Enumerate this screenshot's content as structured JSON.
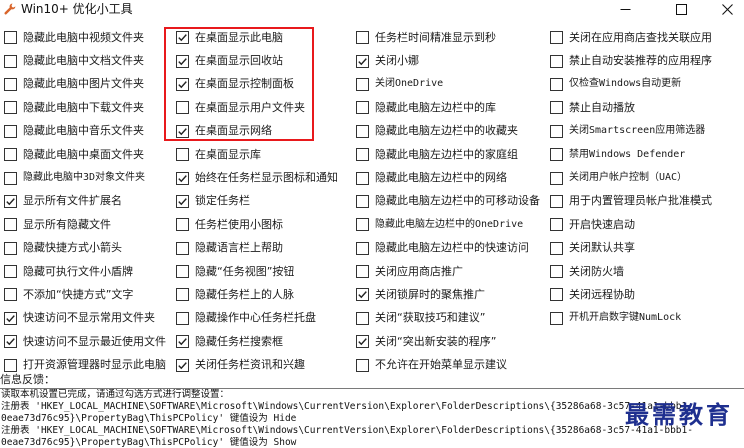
{
  "window": {
    "title": "Win10+ 优化小工具",
    "icon": "wrench-icon"
  },
  "columns": [
    [
      {
        "label": "隐藏此电脑中视频文件夹",
        "checked": false
      },
      {
        "label": "隐藏此电脑中文档文件夹",
        "checked": false
      },
      {
        "label": "隐藏此电脑中图片文件夹",
        "checked": false
      },
      {
        "label": "隐藏此电脑中下载文件夹",
        "checked": false
      },
      {
        "label": "隐藏此电脑中音乐文件夹",
        "checked": false
      },
      {
        "label": "隐藏此电脑中桌面文件夹",
        "checked": false
      },
      {
        "label": "隐藏此电脑中3D对象文件夹",
        "checked": false
      },
      {
        "label": "显示所有文件扩展名",
        "checked": true
      },
      {
        "label": "显示所有隐藏文件",
        "checked": false
      },
      {
        "label": "隐藏快捷方式小箭头",
        "checked": false
      },
      {
        "label": "隐藏可执行文件小盾牌",
        "checked": false
      },
      {
        "label": "不添加“快捷方式”文字",
        "checked": false
      },
      {
        "label": "快速访问不显示常用文件夹",
        "checked": true
      },
      {
        "label": "快速访问不显示最近使用文件",
        "checked": true
      },
      {
        "label": "打开资源管理器时显示此电脑",
        "checked": false
      }
    ],
    [
      {
        "label": "在桌面显示此电脑",
        "checked": true
      },
      {
        "label": "在桌面显示回收站",
        "checked": true
      },
      {
        "label": "在桌面显示控制面板",
        "checked": true
      },
      {
        "label": "在桌面显示用户文件夹",
        "checked": false
      },
      {
        "label": "在桌面显示网络",
        "checked": true
      },
      {
        "label": "在桌面显示库",
        "checked": false
      },
      {
        "label": "始终在任务栏显示图标和通知",
        "checked": true
      },
      {
        "label": "锁定任务栏",
        "checked": true
      },
      {
        "label": "任务栏使用小图标",
        "checked": false
      },
      {
        "label": "隐藏语言栏上帮助",
        "checked": false
      },
      {
        "label": "隐藏“任务视图”按钮",
        "checked": false
      },
      {
        "label": "隐藏任务栏上的人脉",
        "checked": false
      },
      {
        "label": "隐藏操作中心任务栏托盘",
        "checked": false
      },
      {
        "label": "隐藏任务栏搜索框",
        "checked": true
      },
      {
        "label": "关闭任务栏资讯和兴趣",
        "checked": true
      }
    ],
    [
      {
        "label": "任务栏时间精准显示到秒",
        "checked": false
      },
      {
        "label": "关闭小娜",
        "checked": true
      },
      {
        "label": "关闭OneDrive",
        "checked": false
      },
      {
        "label": "隐藏此电脑左边栏中的库",
        "checked": false
      },
      {
        "label": "隐藏此电脑左边栏中的收藏夹",
        "checked": false
      },
      {
        "label": "隐藏此电脑左边栏中的家庭组",
        "checked": false
      },
      {
        "label": "隐藏此电脑左边栏中的网络",
        "checked": false
      },
      {
        "label": "隐藏此电脑左边栏中的可移动设备",
        "checked": false
      },
      {
        "label": "隐藏此电脑左边栏中的OneDrive",
        "checked": false
      },
      {
        "label": "隐藏此电脑左边栏中的快速访问",
        "checked": false
      },
      {
        "label": "关闭应用商店推广",
        "checked": false
      },
      {
        "label": "关闭锁屏时的聚焦推广",
        "checked": true
      },
      {
        "label": "关闭“获取技巧和建议”",
        "checked": false
      },
      {
        "label": "关闭“突出新安装的程序”",
        "checked": true
      },
      {
        "label": "不允许在开始菜单显示建议",
        "checked": false
      }
    ],
    [
      {
        "label": "关闭在应用商店查找关联应用",
        "checked": false
      },
      {
        "label": "禁止自动安装推荐的应用程序",
        "checked": false
      },
      {
        "label": "仅检查Windows自动更新",
        "checked": false
      },
      {
        "label": "禁止自动播放",
        "checked": false
      },
      {
        "label": "关闭Smartscreen应用筛选器",
        "checked": false
      },
      {
        "label": "禁用Windows Defender",
        "checked": false
      },
      {
        "label": "关闭用户帐户控制（UAC）",
        "checked": false
      },
      {
        "label": "用于内置管理员帐户批准模式",
        "checked": false
      },
      {
        "label": "开启快速启动",
        "checked": false
      },
      {
        "label": "关闭默认共享",
        "checked": false
      },
      {
        "label": "关闭防火墙",
        "checked": false
      },
      {
        "label": "关闭远程协助",
        "checked": false
      },
      {
        "label": "开机开启数字键NumLock",
        "checked": false
      }
    ]
  ],
  "feedback": {
    "label": "信息反馈：",
    "lines": [
      "读取本机设置已完成，请通过勾选方式进行调整设置：",
      "注册表 'HKEY_LOCAL_MACHINE\\SOFTWARE\\Microsoft\\Windows\\CurrentVersion\\Explorer\\FolderDescriptions\\{35286a68-3c57-41a1-bbb1-",
      "0eae73d76c95}\\PropertyBag\\ThisPCPolicy' 键值设为 Hide",
      "注册表 'HKEY_LOCAL_MACHINE\\SOFTWARE\\Microsoft\\Windows\\CurrentVersion\\Explorer\\FolderDescriptions\\{35286a68-3c57-41a1-bbb1-",
      "0eae73d76c95}\\PropertyBag\\ThisPCPolicy' 键值设为 Show"
    ]
  },
  "watermark": "最需教育",
  "colors": {
    "highlight": "#e8191c",
    "watermark": "#1e2f8f"
  }
}
